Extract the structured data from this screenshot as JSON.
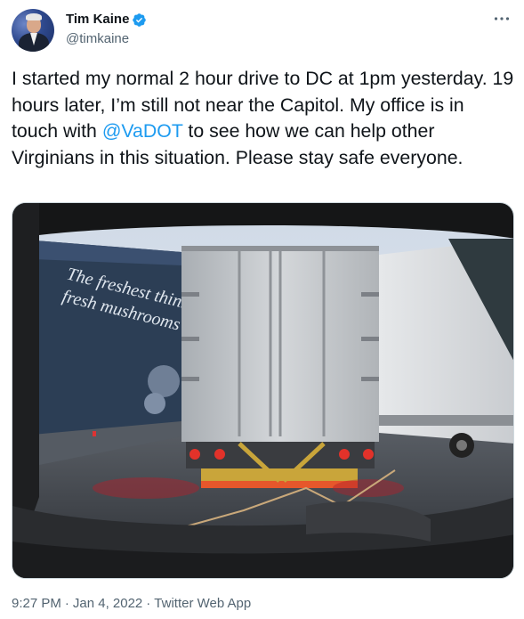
{
  "user": {
    "name": "Tim Kaine",
    "handle": "@timkaine",
    "verified": true
  },
  "tweet": {
    "text_before": "I started my normal 2 hour drive to DC at 1pm yesterday. 19 hours later, I’m still not near the Capitol. My office is in touch with ",
    "mention": "@VaDOT",
    "text_after": " to see how we can help other Virginians in this situation. Please stay safe everyone.",
    "image_text": "The freshest thinking in fresh mushrooms"
  },
  "meta": {
    "time": "9:27 PM",
    "date": "Jan 4, 2022",
    "separator": "·",
    "source": "Twitter Web App"
  },
  "colors": {
    "link": "#1d9bf0",
    "verified_badge": "#1d9bf0",
    "secondary_text": "#536471",
    "primary_text": "#0f1419"
  },
  "icons": {
    "more": "more-dots-icon",
    "verified": "verified-badge-icon"
  }
}
